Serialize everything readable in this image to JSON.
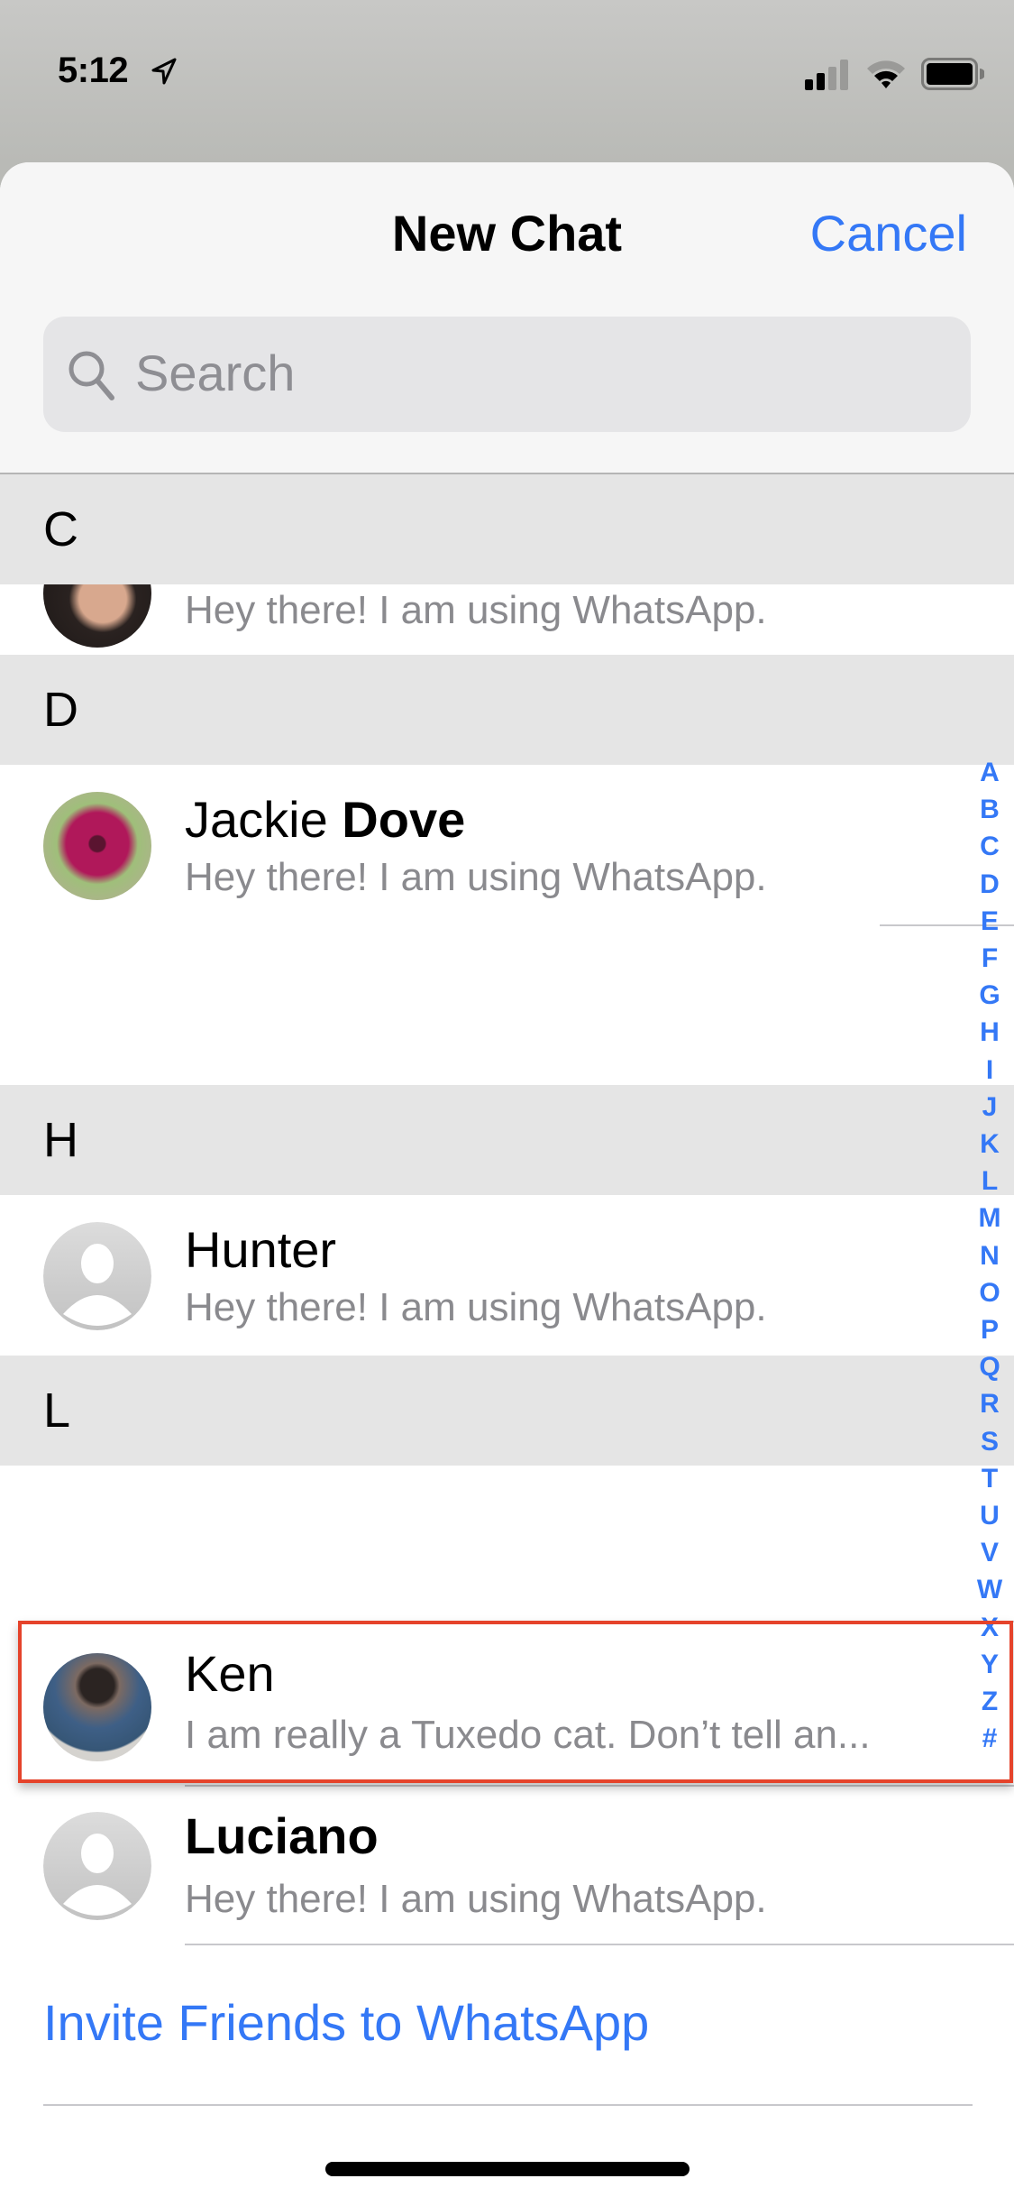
{
  "status_bar": {
    "time": "5:12",
    "location_icon": "location-arrow-icon",
    "signal_bars_filled": 2,
    "signal_bars_total": 4,
    "wifi_arcs_filled": 2,
    "wifi_arcs_total": 3,
    "battery_level": 1.0
  },
  "header": {
    "title": "New Chat",
    "cancel_label": "Cancel"
  },
  "search": {
    "placeholder": "Search",
    "icon": "search-icon"
  },
  "sections": [
    {
      "letter": "C",
      "contacts": [
        {
          "name_first": "",
          "name_last": "",
          "status": "Hey there! I am using WhatsApp.",
          "avatar": "photo"
        }
      ]
    },
    {
      "letter": "D",
      "contacts": [
        {
          "name_first": "Jackie",
          "name_last": "Dove",
          "status": "Hey there! I am using WhatsApp.",
          "avatar": "photo-flower"
        }
      ]
    },
    {
      "letter": "H",
      "contacts": [
        {
          "name_first": "Hunter",
          "name_last": "",
          "status": "Hey there! I am using WhatsApp.",
          "avatar": "placeholder"
        }
      ]
    },
    {
      "letter": "L",
      "contacts": [
        {
          "name_first": "Ken",
          "name_last": "",
          "status": "I am really a Tuxedo cat. Don’t tell an...",
          "avatar": "photo-person",
          "highlighted": true
        },
        {
          "name_first": "",
          "name_last": "Luciano",
          "status": "Hey there! I am using WhatsApp.",
          "avatar": "placeholder"
        }
      ]
    }
  ],
  "index_letters": [
    "A",
    "B",
    "C",
    "D",
    "E",
    "F",
    "G",
    "H",
    "I",
    "J",
    "K",
    "L",
    "M",
    "N",
    "O",
    "P",
    "Q",
    "R",
    "S",
    "T",
    "U",
    "V",
    "W",
    "X",
    "Y",
    "Z",
    "#"
  ],
  "footer": {
    "invite_label": "Invite Friends to WhatsApp"
  },
  "colors": {
    "accent": "#3478f6",
    "highlight_border": "#e5432b",
    "section_bg": "#e5e5e5",
    "secondary_text": "#8a8a8e"
  }
}
